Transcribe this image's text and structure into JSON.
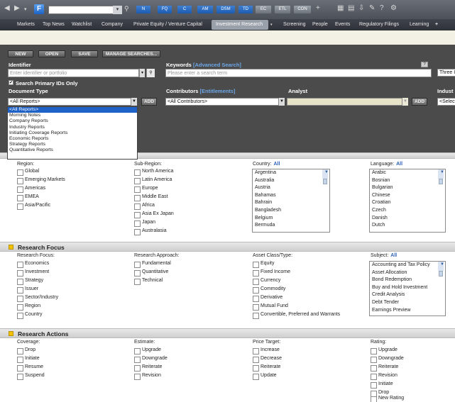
{
  "toolbar": {
    "logo": "F",
    "buttons": [
      "N",
      "FQ",
      "C",
      "AM",
      "DSM",
      "TD",
      "EC",
      "ETL",
      "CON"
    ]
  },
  "nav": {
    "items": [
      "Markets",
      "Top News",
      "Watchlist",
      "Company",
      "Private Equity / Venture Capital",
      "Investment Research",
      "Screening",
      "People",
      "Events",
      "Regulatory Filings",
      "Learning"
    ],
    "active": "Investment Research",
    "plus": "+"
  },
  "actions": {
    "new": "NEW",
    "open": "OPEN",
    "save": "SAVE",
    "manage": "MANAGE SEARCHES..."
  },
  "identifier": {
    "label": "Identifier",
    "placeholder": "Enter identifier or portfolio",
    "primary_only": "Search Primary IDs Only"
  },
  "keywords": {
    "label": "Keywords",
    "advanced": "[Advanced Search]",
    "placeholder": "Please enter a search term",
    "help": "?",
    "range": "Three I"
  },
  "document_type": {
    "label": "Document Type",
    "selected": "<All Reports>",
    "add": "ADD",
    "options": [
      "<All Reports>",
      "Morning Notes",
      "Company Reports",
      "Industry Reports",
      "Initiating Coverage Reports",
      "Economic Reports",
      "Strategy Reports",
      "Quantitative Reports"
    ]
  },
  "contributors": {
    "label": "Contributors",
    "entitlements": "[Entitlements]",
    "selected": "<All Contributors>"
  },
  "analyst": {
    "label": "Analyst",
    "add": "ADD"
  },
  "industry": {
    "label": "Indust",
    "selected": "<Select"
  },
  "geo": {
    "region_label": "Region:",
    "regions": [
      "Global",
      "Emerging Markets",
      "Americas",
      "EMEA",
      "Asia/Pacific"
    ],
    "subregion_label": "Sub-Region:",
    "subregions": [
      "North America",
      "Latin America",
      "Europe",
      "Middle East",
      "Africa",
      "Asia Ex Japan",
      "Japan",
      "Australasia"
    ],
    "country_label": "Country:",
    "countries": [
      "Argentina",
      "Australia",
      "Austria",
      "Bahamas",
      "Bahrain",
      "Bangladesh",
      "Belgium",
      "Bermuda"
    ],
    "language_label": "Language:",
    "languages": [
      "Arabic",
      "Bosnian",
      "Bulgarian",
      "Chinese",
      "Croatian",
      "Czech",
      "Danish",
      "Dutch"
    ],
    "all": "All"
  },
  "focus": {
    "title": "Research Focus",
    "focus_label": "Research Focus:",
    "focus_items": [
      "Economics",
      "Investment",
      "Strategy",
      "Issuer",
      "Sector/Industry",
      "Region",
      "Country"
    ],
    "approach_label": "Research Approach:",
    "approach_items": [
      "Fundamental",
      "Quantitative",
      "Technical"
    ],
    "asset_label": "Asset Class/Type:",
    "asset_items": [
      "Equity",
      "Fixed Income",
      "Currency",
      "Commodity",
      "Derivative",
      "Mutual Fund",
      "Convertible, Preferred and Warrants"
    ],
    "subject_label": "Subject:",
    "subjects": [
      "Accounting and Tax Policy",
      "Asset Allocation",
      "Bond Redemption",
      "Buy and Hold Investment",
      "Credit Analysis",
      "Debt Tender",
      "Earnings Preview"
    ],
    "all": "All"
  },
  "actions_sec": {
    "title": "Research Actions",
    "coverage_label": "Coverage:",
    "coverage": [
      "Drop",
      "Initiate",
      "Resume",
      "Suspend"
    ],
    "estimate_label": "Estimate:",
    "estimate": [
      "Upgrade",
      "Downgrade",
      "Reiterate",
      "Revision"
    ],
    "price_label": "Price Target:",
    "price": [
      "Increase",
      "Decrease",
      "Reiterate",
      "Update"
    ],
    "rating_label": "Rating:",
    "rating": [
      "Upgrade",
      "Downgrade",
      "Reiterate",
      "Revision",
      "Initiate",
      "Drop",
      "New Rating"
    ]
  }
}
